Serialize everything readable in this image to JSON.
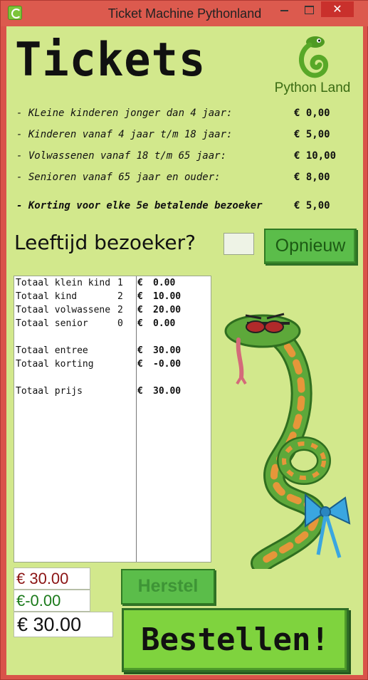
{
  "window": {
    "title": "Ticket Machine Pythonland",
    "close_glyph": "✕"
  },
  "header": {
    "title": "Tickets",
    "logo_text": "Python Land"
  },
  "prices": [
    {
      "desc": "- KLeine kinderen jonger dan 4 jaar:",
      "price": "€ 0,00"
    },
    {
      "desc": "- Kinderen vanaf 4 jaar t/m 18 jaar:",
      "price": "€ 5,00"
    },
    {
      "desc": "- Volwassenen vanaf 18 t/m 65 jaar:",
      "price": "€ 10,00"
    },
    {
      "desc": "- Senioren vanaf 65 jaar en ouder:",
      "price": "€ 8,00"
    },
    {
      "desc": "- Korting voor elke 5e betalende bezoeker",
      "price": "€ 5,00"
    }
  ],
  "age": {
    "label": "Leeftijd bezoeker?",
    "value": "",
    "reset_label": "Opnieuw"
  },
  "summary": {
    "rows": [
      {
        "label": "Totaal klein kind",
        "count": "1",
        "currency": "€",
        "value": "0.00"
      },
      {
        "label": "Totaal kind",
        "count": "2",
        "currency": "€",
        "value": "10.00"
      },
      {
        "label": "Totaal volwassene",
        "count": "2",
        "currency": "€",
        "value": "20.00"
      },
      {
        "label": "Totaal senior",
        "count": "0",
        "currency": "€",
        "value": "0.00"
      },
      {
        "label": "Totaal entree",
        "count": "",
        "currency": "€",
        "value": "30.00"
      },
      {
        "label": "Totaal korting",
        "count": "",
        "currency": "€",
        "value": "-0.00"
      },
      {
        "label": "Totaal prijs",
        "count": "",
        "currency": "€",
        "value": "30.00"
      }
    ]
  },
  "totals": {
    "total": "€ 30.00",
    "discount": "€-0.00",
    "to_pay": "€ 30.00"
  },
  "buttons": {
    "herstel": "Herstel",
    "order": "Bestellen!"
  },
  "colors": {
    "background": "#d2e88c",
    "button_green": "#5bbd4a",
    "order_green": "#7fd33e",
    "total_red": "#8b1414",
    "discount_green": "#1b7a1b"
  }
}
